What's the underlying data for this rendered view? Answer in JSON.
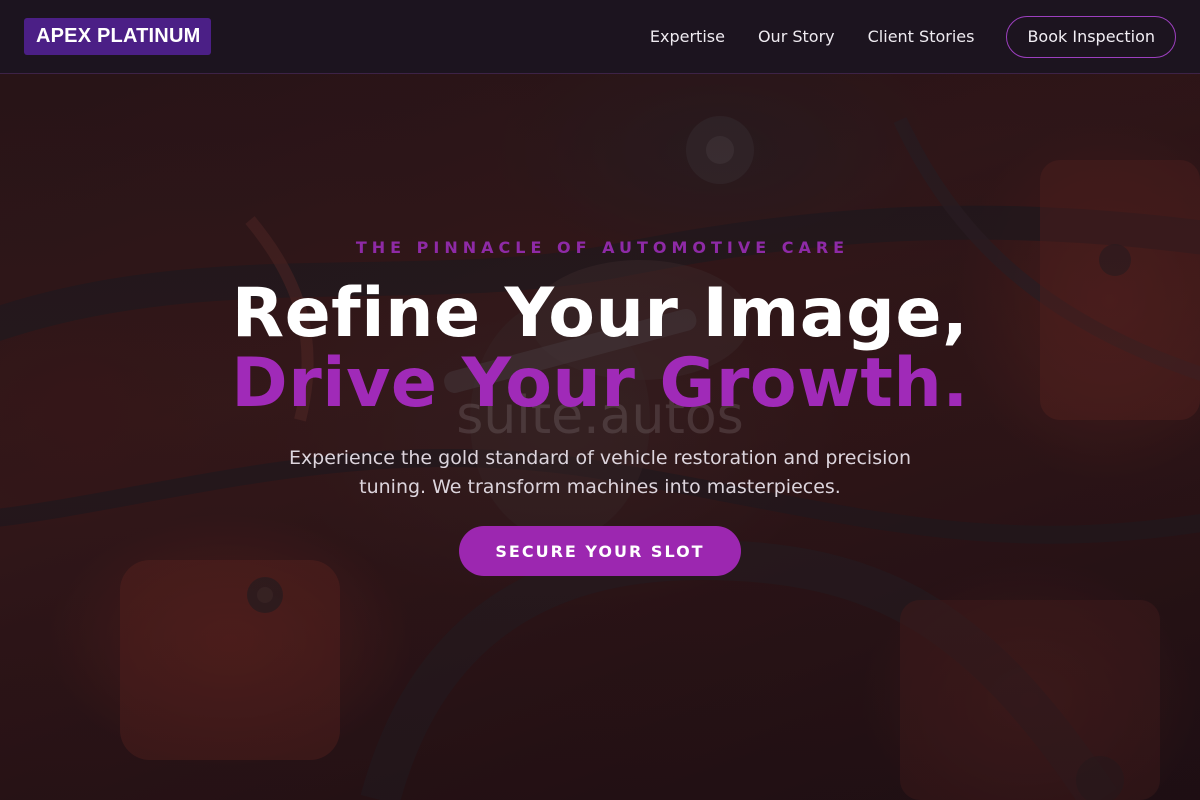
{
  "nav": {
    "logo_text": "APEX PLATINUM",
    "links": [
      {
        "label": "Expertise"
      },
      {
        "label": "Our Story"
      },
      {
        "label": "Client Stories"
      }
    ],
    "cta_label": "Book Inspection"
  },
  "hero": {
    "eyebrow": "THE PINNACLE OF AUTOMOTIVE CARE",
    "title_line1": "Refine Your Image,",
    "title_line2": "Drive Your Growth.",
    "watermark": "suite.autos",
    "subtitle": "Experience the gold standard of vehicle restoration and precision tuning. We transform machines into masterpieces.",
    "cta_label": "SECURE YOUR SLOT"
  },
  "colors": {
    "accent": "#9c27b0",
    "logo_bg": "#4b1f86",
    "nav_bg": "#1c141f"
  }
}
